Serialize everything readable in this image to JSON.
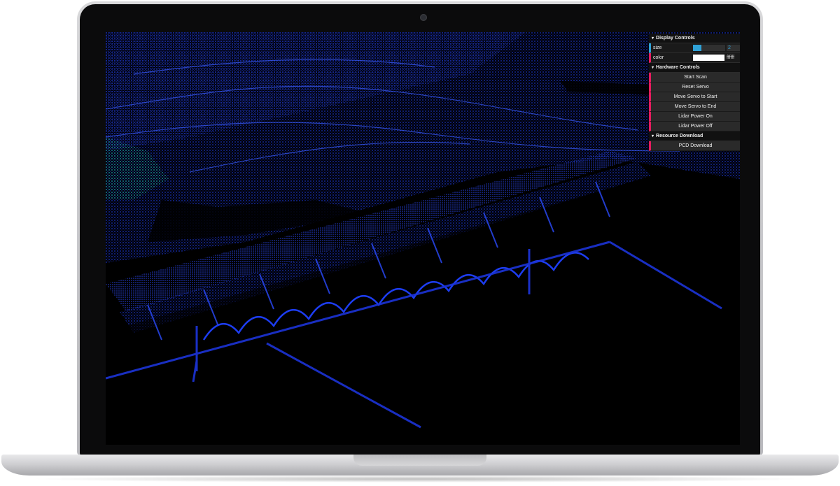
{
  "gui": {
    "display_controls": {
      "title": "Display Controls",
      "size_label": "size",
      "size_value": "2",
      "size_fraction": 0.25,
      "color_label": "color",
      "color_value": "ffffff",
      "color_hex": "#ffffff"
    },
    "hardware_controls": {
      "title": "Hardware Controls",
      "buttons": [
        "Start Scan",
        "Reset Servo",
        "Move Servo to Start",
        "Move Servo to End",
        "Lidar Power On",
        "Lidar Power Off"
      ]
    },
    "resource_download": {
      "title": "Resource Download",
      "buttons": [
        "PCD Download"
      ]
    }
  },
  "colors": {
    "point_cloud": "#1a2fd8",
    "point_cloud_highlight": "#2f6bff",
    "point_cloud_green": "#1aa89a",
    "gui_accent": "#2fa1d6",
    "gui_button_accent": "#e61d5f"
  },
  "icons": {
    "folder_toggle": "chevron-down-icon",
    "camera": "webcam-icon"
  }
}
